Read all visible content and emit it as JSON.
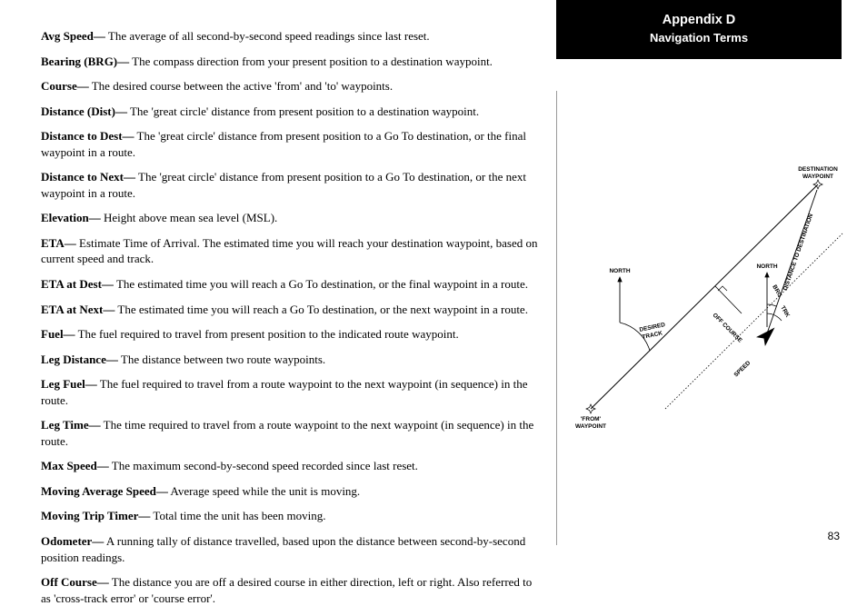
{
  "header": {
    "title": "Appendix D",
    "subtitle": "Navigation Terms"
  },
  "definitions": [
    {
      "term": "Avg Speed—",
      "desc": " The average of all second-by-second speed readings since last reset."
    },
    {
      "term": "Bearing (BRG)—",
      "desc": " The compass direction from your present position to a destination waypoint."
    },
    {
      "term": "Course—",
      "desc": " The desired course between the active 'from' and 'to' waypoints."
    },
    {
      "term": "Distance (Dist)—",
      "desc": " The 'great circle' distance from present position to a destination waypoint."
    },
    {
      "term": "Distance to Dest—",
      "desc": " The 'great circle' distance from present position to a Go To destination, or the final waypoint in a route."
    },
    {
      "term": "Distance to Next—",
      "desc": " The 'great circle' distance from present position to a Go To destination, or the next waypoint in a route."
    },
    {
      "term": "Elevation—",
      "desc": " Height above mean sea level (MSL)."
    },
    {
      "term": "ETA—",
      "desc": " Estimate Time of Arrival. The estimated time you will reach your destination waypoint, based on current speed and track."
    },
    {
      "term": "ETA at Dest—",
      "desc": " The estimated time you will reach a Go To destination, or the final waypoint in a route."
    },
    {
      "term": "ETA at Next—",
      "desc": " The estimated time you will reach a Go To destination, or the next waypoint in a route."
    },
    {
      "term": "Fuel—",
      "desc": " The fuel required to travel from present position to the indicated route waypoint."
    },
    {
      "term": "Leg Distance—",
      "desc": " The distance between two route waypoints."
    },
    {
      "term": "Leg Fuel—",
      "desc": " The fuel required to travel from a route waypoint to the next waypoint (in sequence) in the route."
    },
    {
      "term": "Leg Time—",
      "desc": " The time required to travel from a route waypoint to the next waypoint (in sequence) in the route."
    },
    {
      "term": "Max Speed—",
      "desc": " The maximum second-by-second speed recorded since last reset."
    },
    {
      "term": "Moving Average Speed—",
      "desc": " Average speed while the unit is moving."
    },
    {
      "term": "Moving Trip Timer—",
      "desc": " Total time the unit has been moving."
    },
    {
      "term": "Odometer—",
      "desc": " A running tally of distance travelled, based upon the distance between second-by-second position readings."
    },
    {
      "term": "Off Course—",
      "desc": " The distance you are off a desired course in either direction, left or right. Also referred to as 'cross-track error' or 'course error'."
    }
  ],
  "diagram": {
    "labels": {
      "destination": "DESTINATION",
      "waypoint": "WAYPOINT",
      "north": "NORTH",
      "distance_to_destination": "DISTANCE TO DESTINATION",
      "brg": "BRG",
      "trk": "TRK",
      "off_course": "OFF COURSE",
      "desired_track": "DESIRED",
      "track_word": "TRACK",
      "speed": "SPEED",
      "from": "'FROM'"
    }
  },
  "page_number": "83"
}
